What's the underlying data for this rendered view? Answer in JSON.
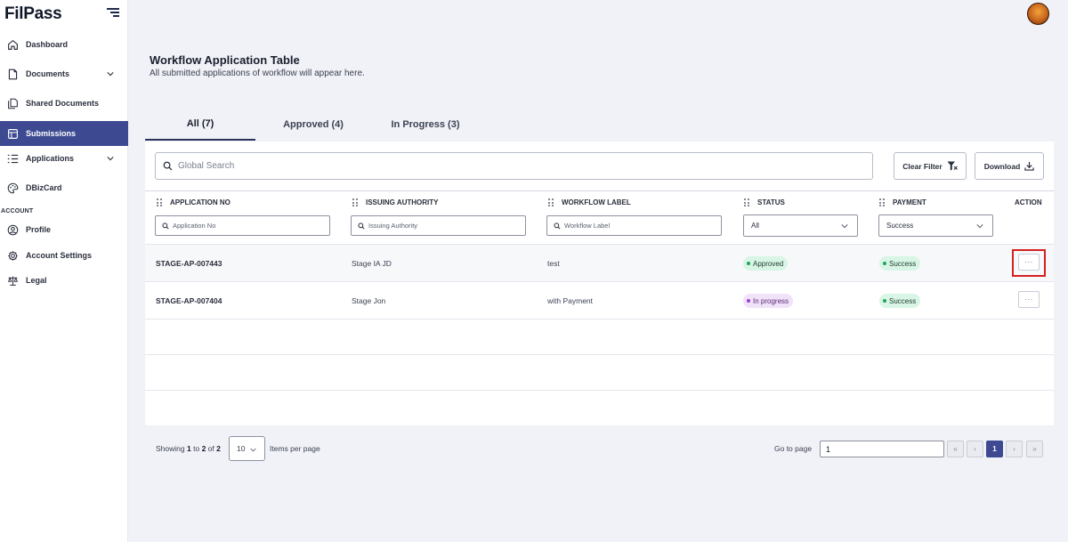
{
  "app": {
    "logo": "FilPass"
  },
  "sidebar": {
    "items": [
      {
        "label": "Dashboard",
        "icon": "home-icon",
        "active": false
      },
      {
        "label": "Documents",
        "icon": "document-icon",
        "active": false,
        "expandable": true
      },
      {
        "label": "Shared Documents",
        "icon": "shared-documents-icon",
        "active": false
      },
      {
        "label": "Submissions",
        "icon": "submissions-icon",
        "active": true
      },
      {
        "label": "Applications",
        "icon": "applications-icon",
        "active": false,
        "expandable": true
      },
      {
        "label": "DBizCard",
        "icon": "palette-icon",
        "active": false
      }
    ],
    "section_label": "ACCOUNT",
    "account_items": [
      {
        "label": "Profile",
        "icon": "user-icon"
      },
      {
        "label": "Account Settings",
        "icon": "gear-icon"
      },
      {
        "label": "Legal",
        "icon": "scale-icon"
      }
    ]
  },
  "header": {
    "title": "Workflow Application Table",
    "subtitle": "All submitted applications of workflow will appear here."
  },
  "tabs": [
    {
      "label": "All (7)",
      "active": true
    },
    {
      "label": "Approved (4)",
      "active": false
    },
    {
      "label": "In Progress (3)",
      "active": false
    }
  ],
  "toolbar": {
    "search_placeholder": "Global Search",
    "clear_filter_label": "Clear Filter",
    "download_label": "Download"
  },
  "table": {
    "columns": [
      {
        "label": "APPLICATION NO",
        "filter_placeholder": "Application No"
      },
      {
        "label": "ISSUING AUTHORITY",
        "filter_placeholder": "Issuing Authority"
      },
      {
        "label": "WORKFLOW LABEL",
        "filter_placeholder": "Workflow Label"
      },
      {
        "label": "STATUS",
        "filter_value": "All"
      },
      {
        "label": "PAYMENT",
        "filter_value": "Success"
      },
      {
        "label": "ACTION"
      }
    ],
    "rows": [
      {
        "application_no": "STAGE-AP-007443",
        "issuing_authority": "Stage IA JD",
        "workflow_label": "test",
        "status": "Approved",
        "payment": "Success",
        "action": "···"
      },
      {
        "application_no": "STAGE-AP-007404",
        "issuing_authority": "Stage Jon",
        "workflow_label": "with Payment",
        "status": "In progress",
        "payment": "Success",
        "action": "···"
      }
    ]
  },
  "pagination": {
    "showing_prefix": "Showing",
    "from": "1",
    "to_word": "to",
    "to": "2",
    "of_word": "of",
    "total": "2",
    "per_page": "10",
    "per_page_label": "Items per page",
    "goto_label": "Go to page",
    "goto_value": "1",
    "current_page": "1",
    "first": "«",
    "prev": "‹",
    "next": "›",
    "last": "»"
  },
  "colors": {
    "primary": "#3d4a92",
    "approved_bg": "#d8f5e5",
    "in_progress_bg": "#f0e2f8",
    "highlight": "#d42020"
  }
}
